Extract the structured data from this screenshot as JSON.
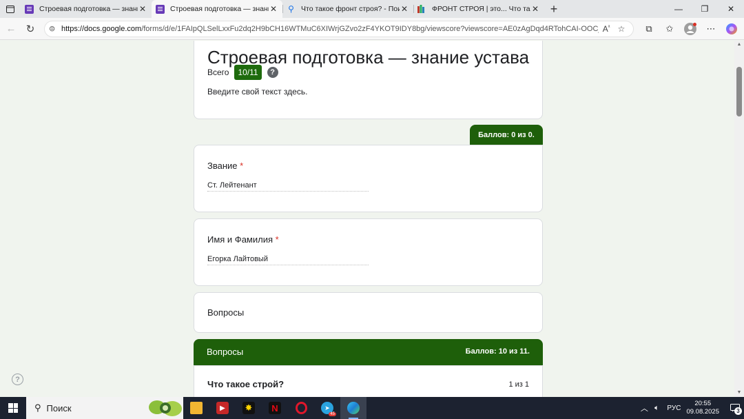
{
  "tabs": [
    {
      "title": "Строевая подготовка — знание",
      "active": false
    },
    {
      "title": "Строевая подготовка — знание",
      "active": true
    },
    {
      "title": "Что такое фронт строя? - Поиск",
      "active": false
    },
    {
      "title": "ФРОНТ СТРОЯ | это... Что такое",
      "active": false
    }
  ],
  "address": {
    "host": "https://docs.google.com",
    "path": "/forms/d/e/1FAIpQLSelLxxFu2dq2H9bCH16WTMuC6XIWrjGZvo2zF4YKOT9IDY8bg/viewscore?viewscore=AE0zAgDqd4RTohCAI-OOCjz..."
  },
  "form": {
    "title": "Строевая подготовка — знание устава",
    "total_label": "Всего",
    "total_score": "10/11",
    "help_glyph": "?",
    "description": "Введите свой текст здесь."
  },
  "points_tab": "Баллов: 0 из 0.",
  "questions": {
    "rank": {
      "label": "Звание",
      "required": "*",
      "answer": "Ст. Лейтенант"
    },
    "name": {
      "label": "Имя и Фамилия",
      "required": "*",
      "answer": "Егорка Лайтовый"
    }
  },
  "section_card": {
    "label": "Вопросы"
  },
  "section_header": {
    "title": "Вопросы",
    "score": "Баллов: 10 из 11."
  },
  "first_question": {
    "text": "Что такое строй?",
    "score": "1 из 1"
  },
  "taskbar": {
    "search_label": "Поиск",
    "lang": "РУС",
    "time": "20:55",
    "date": "09.08.2025",
    "notif_count": "3",
    "telegram_badge": "45"
  }
}
